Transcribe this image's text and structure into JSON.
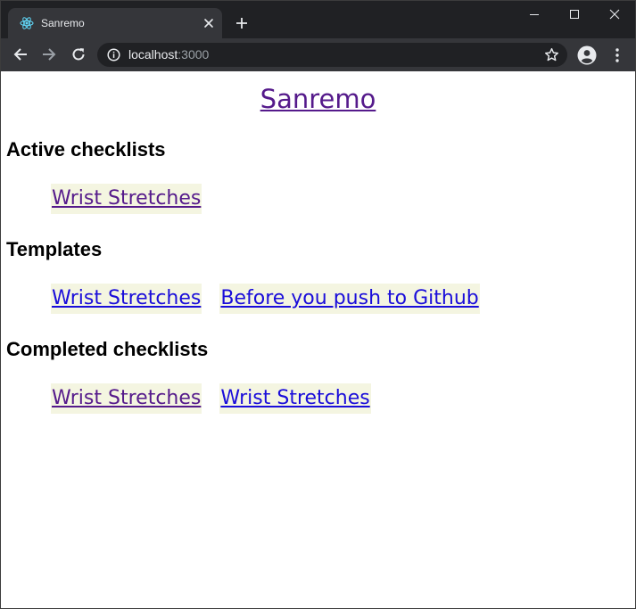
{
  "browser": {
    "tab": {
      "title": "Sanremo",
      "favicon": "react-logo-icon"
    },
    "address_bar": {
      "host": "localhost",
      "port": ":3000"
    },
    "icons": {
      "back": "arrow-left-icon",
      "forward": "arrow-right-icon",
      "reload": "reload-icon",
      "info": "info-icon",
      "bookmark": "star-icon",
      "profile": "account-circle-icon",
      "menu": "kebab-menu-icon",
      "new_tab": "plus-icon",
      "close_tab": "close-icon",
      "minimize": "minimize-icon",
      "maximize": "maximize-icon",
      "close_window": "close-icon"
    },
    "colors": {
      "titlebar": "#202124",
      "toolbar": "#35363a",
      "omnibox": "#202124",
      "text": "#e8eaed",
      "muted_text": "#9aa0a6"
    }
  },
  "page": {
    "title": "Sanremo",
    "sections": {
      "active": {
        "heading": "Active checklists",
        "items": [
          {
            "label": "Wrist Stretches",
            "visited": true
          }
        ]
      },
      "templates": {
        "heading": "Templates",
        "items": [
          {
            "label": "Wrist Stretches",
            "visited": false
          },
          {
            "label": "Before you push to Github",
            "visited": false
          }
        ]
      },
      "completed": {
        "heading": "Completed checklists",
        "items": [
          {
            "label": "Wrist Stretches",
            "visited": true
          },
          {
            "label": "Wrist Stretches",
            "visited": false
          }
        ]
      }
    },
    "colors": {
      "visited_link": "#551a8b",
      "unvisited_link": "#1a0dda",
      "item_background": "#f4f5e1"
    }
  }
}
